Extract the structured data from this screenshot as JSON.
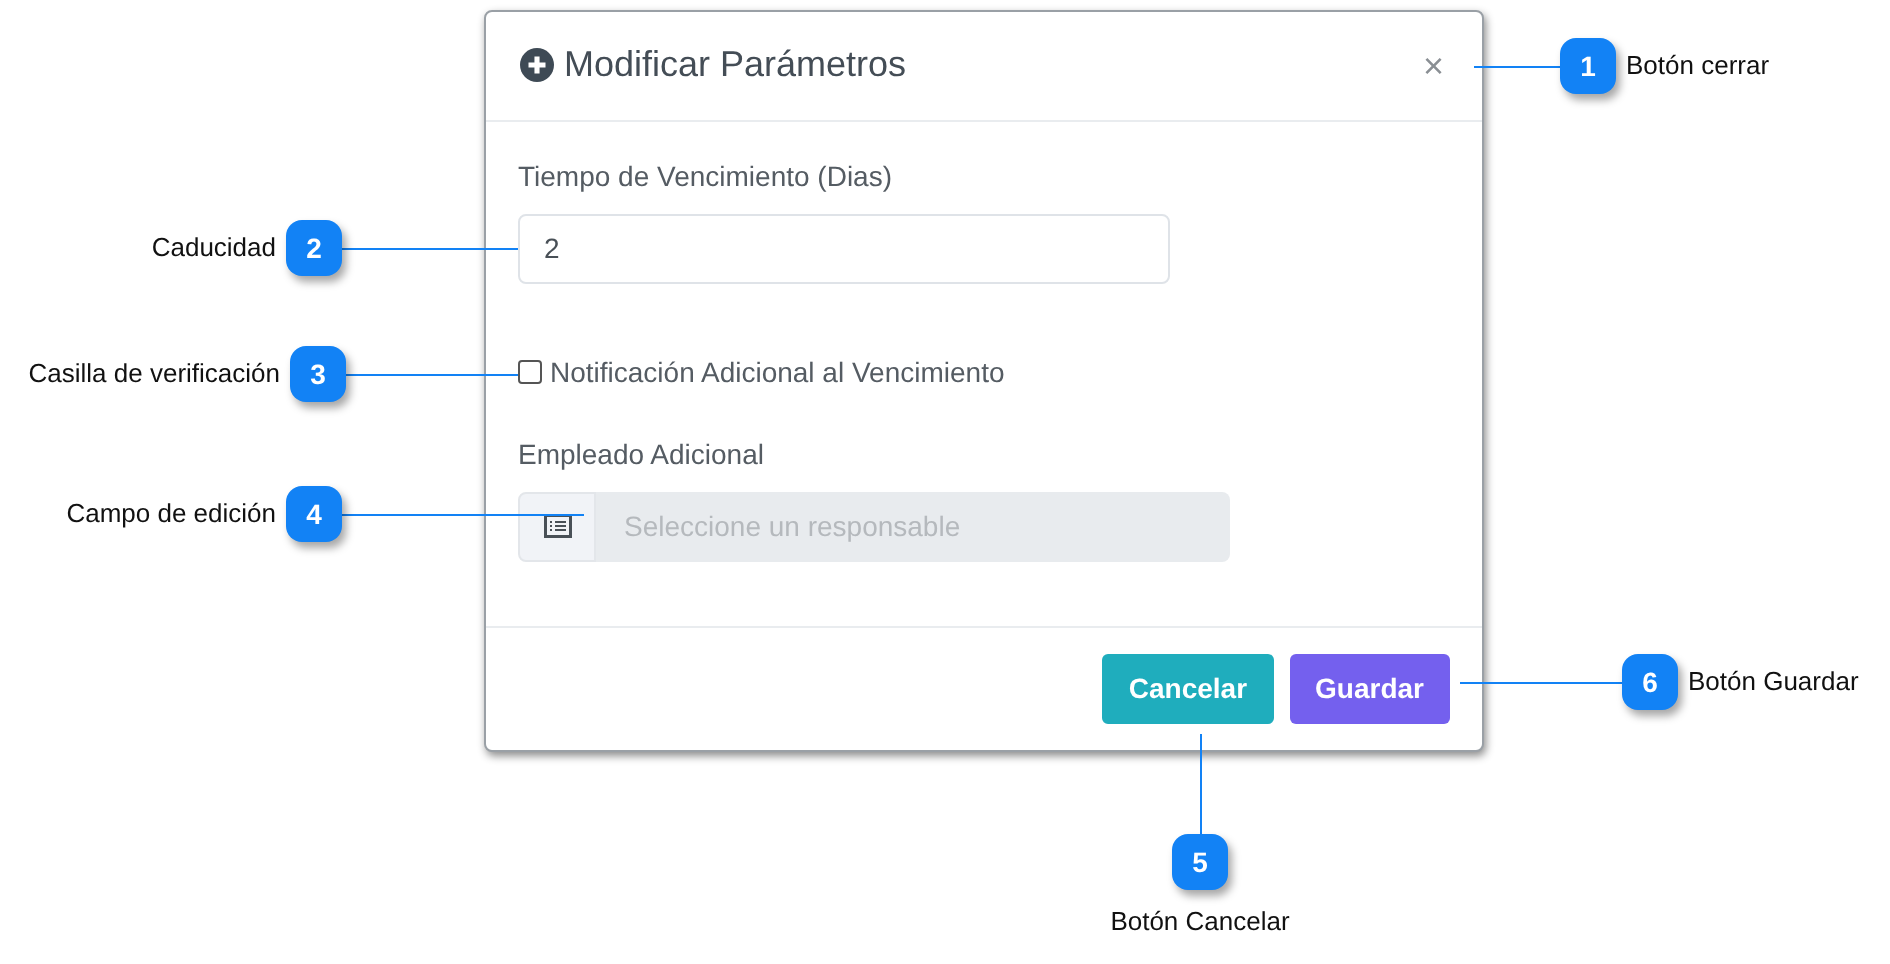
{
  "dialog": {
    "title": "Modificar Parámetros",
    "close": "×",
    "fields": [
      {
        "kind": "text",
        "label": "Tiempo de Vencimiento (Dias)",
        "value": "2"
      },
      {
        "kind": "checkbox",
        "label": "Notificación Adicional al Vencimiento",
        "checked": false
      },
      {
        "kind": "picker",
        "label": "Empleado Adicional",
        "placeholder": "Seleccione un responsable",
        "disabled": true
      }
    ],
    "buttons": [
      {
        "label": "Cancelar",
        "kind": "secondary"
      },
      {
        "label": "Guardar",
        "kind": "primary"
      }
    ]
  },
  "callouts": [
    {
      "number": "1",
      "label": "Botón cerrar"
    },
    {
      "number": "2",
      "label": "Caducidad"
    },
    {
      "number": "3",
      "label": "Casilla de verificación"
    },
    {
      "number": "4",
      "label": "Campo de edición"
    },
    {
      "number": "5",
      "label": "Botón Cancelar"
    },
    {
      "number": "6",
      "label": "Botón Guardar"
    }
  ]
}
